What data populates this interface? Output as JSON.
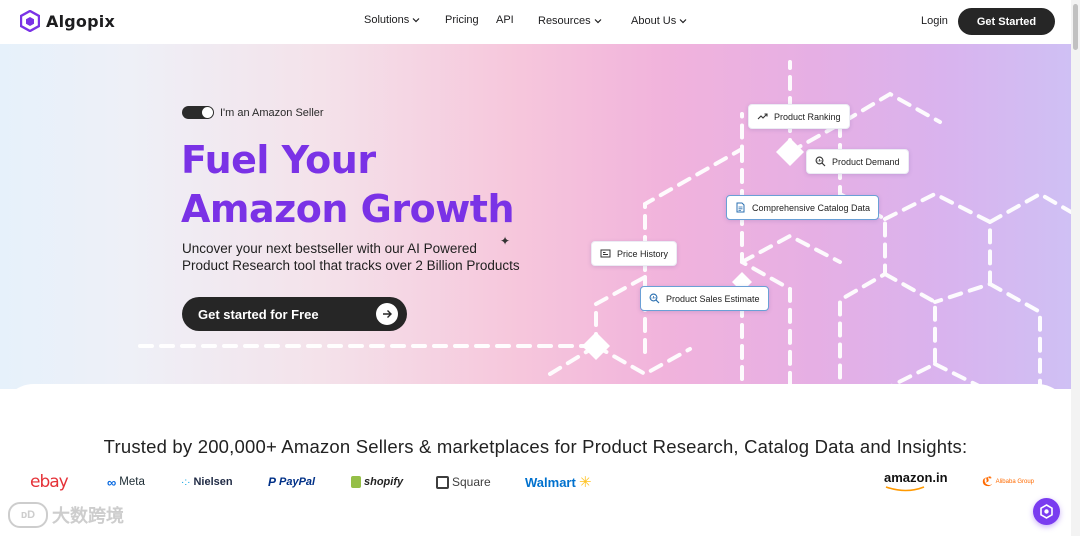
{
  "nav": {
    "brand": "Algopix",
    "links": [
      {
        "label": "Solutions",
        "has_dropdown": true
      },
      {
        "label": "Pricing",
        "has_dropdown": false
      },
      {
        "label": "API",
        "has_dropdown": false
      },
      {
        "label": "Resources",
        "has_dropdown": true
      },
      {
        "label": "About Us",
        "has_dropdown": true
      }
    ],
    "login": "Login",
    "get_started": "Get Started"
  },
  "hero": {
    "toggle_label": "I'm an Amazon Seller",
    "toggle_on": true,
    "headline_line1": "Fuel Your",
    "headline_line2": "Amazon Growth",
    "subline_line1": "Uncover your next bestseller with our AI Powered",
    "subline_line2": "Product Research tool that tracks over 2 Billion Products",
    "cta": "Get started for Free",
    "chips": [
      {
        "label": "Product Ranking",
        "icon": "trending-up-icon"
      },
      {
        "label": "Product Demand",
        "icon": "search-chart-icon"
      },
      {
        "label": "Comprehensive Catalog Data",
        "icon": "document-icon"
      },
      {
        "label": "Price History",
        "icon": "price-tag-icon"
      },
      {
        "label": "Product Sales Estimate",
        "icon": "search-chart-icon"
      }
    ]
  },
  "trusted": {
    "title": "Trusted by 200,000+ Amazon Sellers & marketplaces for Product Research, Catalog Data and Insights:",
    "logos": [
      {
        "name": "ebay",
        "text": "ebay"
      },
      {
        "name": "meta",
        "text": "Meta"
      },
      {
        "name": "nielsen",
        "text": "Nielsen"
      },
      {
        "name": "paypal",
        "text": "PayPal"
      },
      {
        "name": "shopify",
        "text": "shopify"
      },
      {
        "name": "square",
        "text": "Square"
      },
      {
        "name": "walmart",
        "text": "Walmart"
      },
      {
        "name": "amazon-in",
        "text": "amazon.in"
      },
      {
        "name": "alibaba",
        "text": "Alibaba Group"
      }
    ]
  },
  "watermark": {
    "text": "大数跨境"
  },
  "colors": {
    "accent_purple": "#7a32e6",
    "dark_button": "#262626",
    "chat_button": "#7a3cf0"
  }
}
